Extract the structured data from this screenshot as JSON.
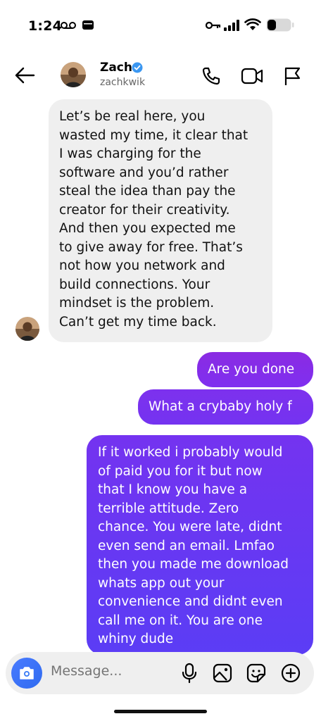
{
  "status_bar": {
    "time": "1:24"
  },
  "header": {
    "contact_name": "Zach",
    "contact_handle": "zachkwik"
  },
  "messages": [
    {
      "from": "them",
      "text": "Let’s be real here, you\nwasted my time, it clear that\nI was charging for the\nsoftware and you’d rather\nsteal the idea than pay the\ncreator for their creativity.\nAnd then you expected me\nto give away for free. That’s\nnot how you network and\nbuild connections. Your\nmindset is the problem.\nCan’t get my time back."
    },
    {
      "from": "me",
      "text": "Are you done"
    },
    {
      "from": "me",
      "text": "What a crybaby holy f"
    },
    {
      "from": "me",
      "text": "If it worked i probably would\nof paid you for it but now\nthat I know you have a\nterrible attitude. Zero\nchance. You were late, didnt\neven send an email. Lmfao\nthen you made me download\nwhats app out your\nconvenience and didnt even\ncall me on it. You are one\nwhiny dude"
    }
  ],
  "composer": {
    "placeholder": "Message..."
  },
  "colors": {
    "sent_gradient_top": "#8a2be2",
    "sent_gradient_bottom": "#5b3df5",
    "received_bg": "#efefef",
    "verified_blue": "#3b97f1"
  },
  "icons": [
    "back-arrow-icon",
    "phone-icon",
    "video-icon",
    "flag-icon",
    "verified-icon",
    "camera-icon",
    "microphone-icon",
    "image-icon",
    "sticker-icon",
    "plus-circle-icon"
  ]
}
